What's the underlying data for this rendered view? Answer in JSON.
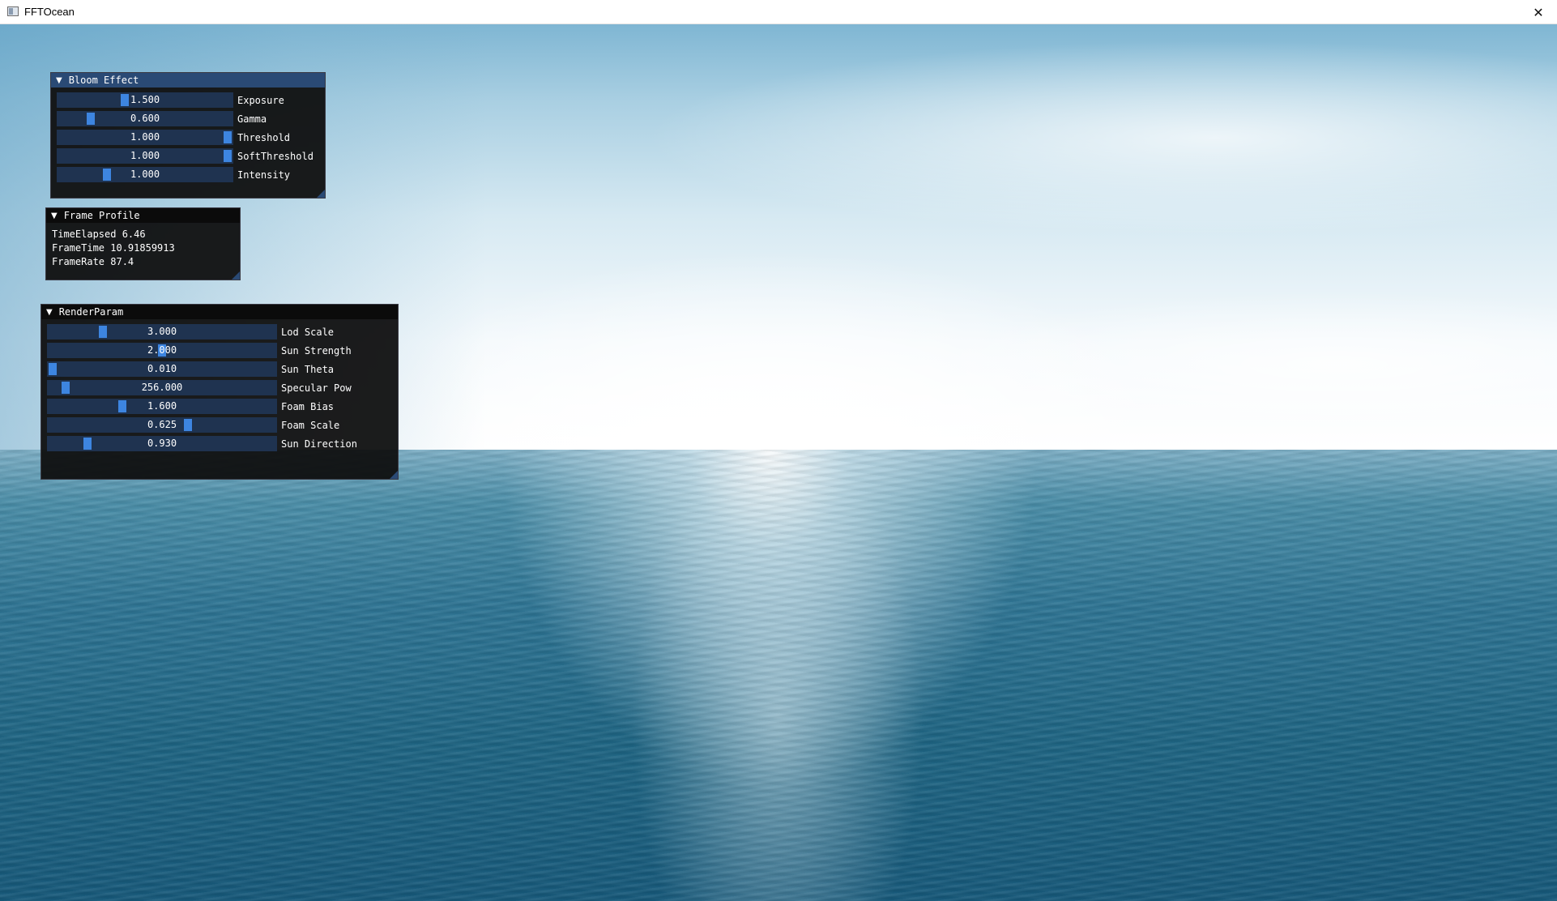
{
  "window": {
    "title": "FFTOcean",
    "close_icon": "close-icon"
  },
  "bloom": {
    "header": "Bloom Effect",
    "rows": [
      {
        "label": "Exposure",
        "value": "1.500",
        "fraction": 0.375
      },
      {
        "label": "Gamma",
        "value": "0.600",
        "fraction": 0.17
      },
      {
        "label": "Threshold",
        "value": "1.000",
        "fraction": 1.0
      },
      {
        "label": "SoftThreshold",
        "value": "1.000",
        "fraction": 1.0
      },
      {
        "label": "Intensity",
        "value": "1.000",
        "fraction": 0.27
      }
    ]
  },
  "profile": {
    "header": "Frame Profile",
    "lines": [
      "TimeElapsed 6.46",
      "FrameTime 10.91859913",
      "FrameRate 87.4"
    ]
  },
  "render": {
    "header": "RenderParam",
    "rows": [
      {
        "label": "Lod Scale",
        "value": "3.000",
        "fraction": 0.23
      },
      {
        "label": "Sun Strength",
        "value": "2.000",
        "fraction": 0.5
      },
      {
        "label": "Sun Theta",
        "value": "0.010",
        "fraction": 0.0
      },
      {
        "label": "Specular Pow",
        "value": "256.000",
        "fraction": 0.06
      },
      {
        "label": "Foam Bias",
        "value": "1.600",
        "fraction": 0.32
      },
      {
        "label": "Foam Scale",
        "value": "0.625",
        "fraction": 0.62
      },
      {
        "label": "Sun Direction",
        "value": "0.930",
        "fraction": 0.16
      }
    ]
  },
  "colors": {
    "panel_bg": "#0e0e0e",
    "header_active": "#2a4a75",
    "slider_frame": "#1f3350",
    "slider_grab": "#3d85e0"
  }
}
